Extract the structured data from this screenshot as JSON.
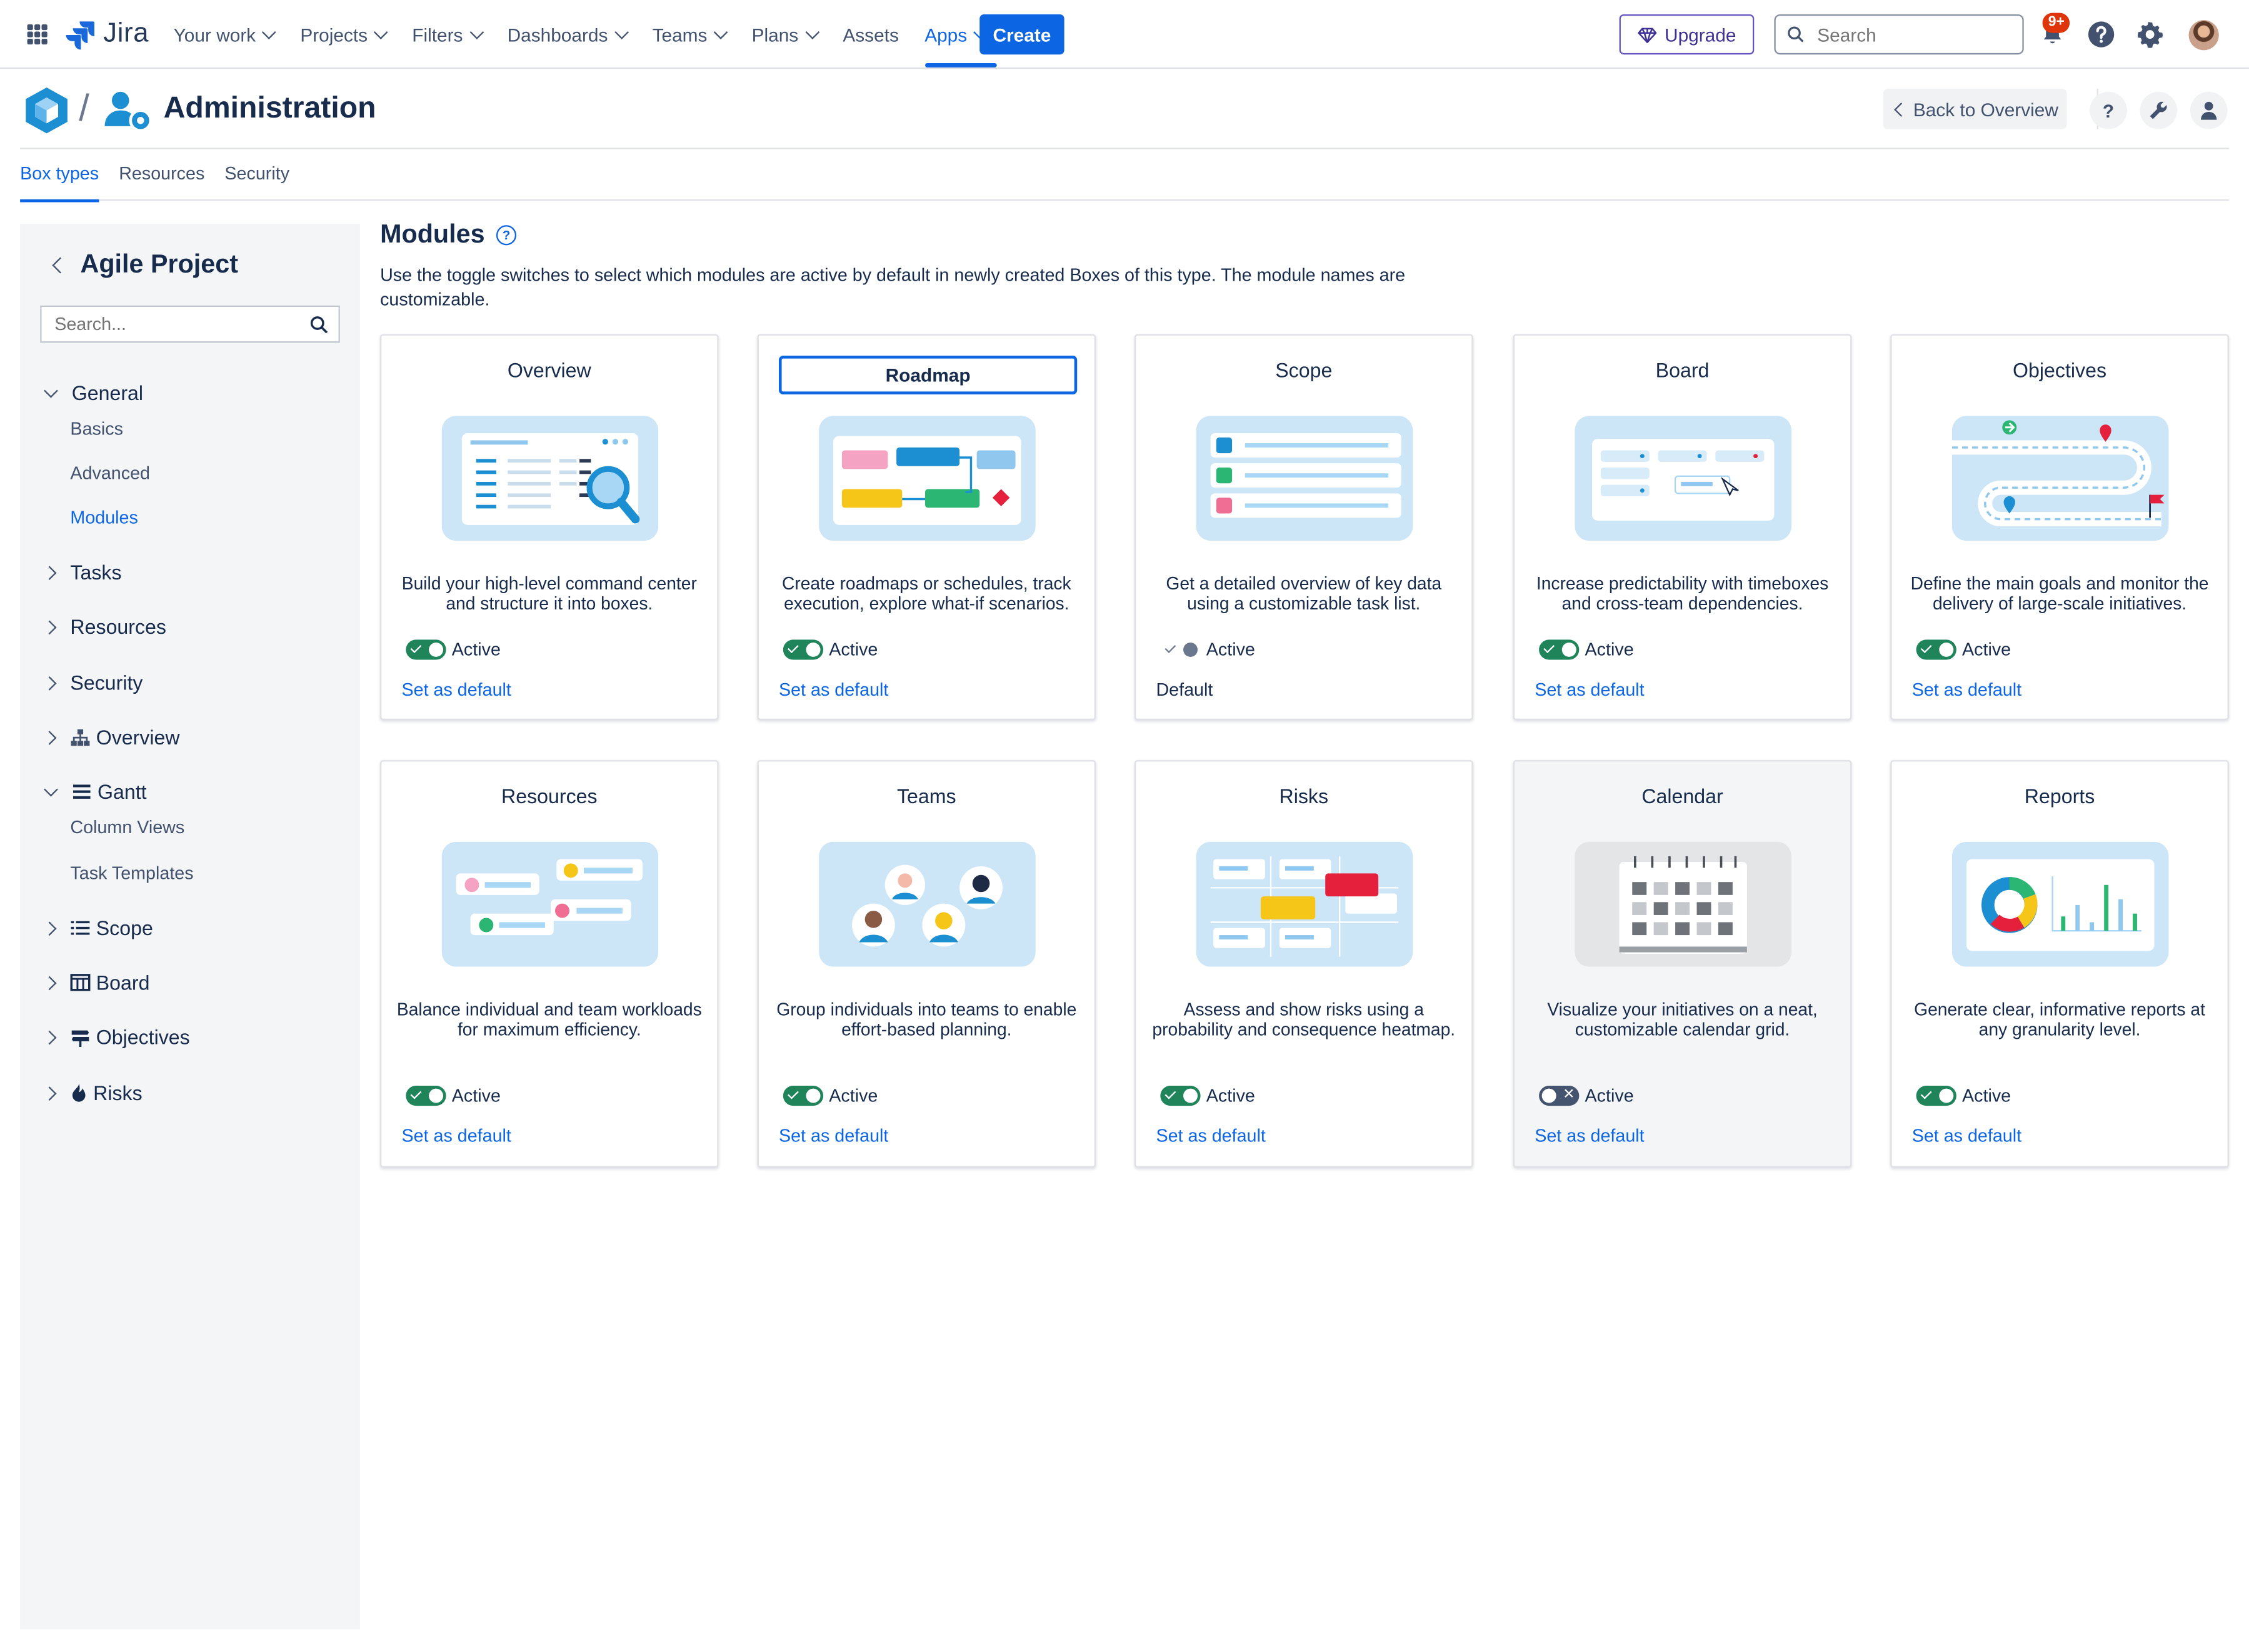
{
  "nav": {
    "product": "Jira",
    "items": [
      {
        "label": "Your work",
        "dropdown": true
      },
      {
        "label": "Projects",
        "dropdown": true
      },
      {
        "label": "Filters",
        "dropdown": true
      },
      {
        "label": "Dashboards",
        "dropdown": true
      },
      {
        "label": "Teams",
        "dropdown": true
      },
      {
        "label": "Plans",
        "dropdown": true
      },
      {
        "label": "Assets",
        "dropdown": false
      },
      {
        "label": "Apps",
        "dropdown": true,
        "active": true
      }
    ],
    "create_label": "Create",
    "upgrade_label": "Upgrade",
    "search_placeholder": "Search",
    "notifications_badge": "9+",
    "accent": "#0C66E4"
  },
  "admin": {
    "title": "Administration",
    "back_label": "Back to Overview",
    "help_glyph": "?"
  },
  "tabs": [
    {
      "label": "Box types",
      "active": true
    },
    {
      "label": "Resources",
      "active": false
    },
    {
      "label": "Security",
      "active": false
    }
  ],
  "sidebar": {
    "title": "Agile Project",
    "search_placeholder": "Search...",
    "groups": [
      {
        "label": "General",
        "expanded": true,
        "icon": null,
        "children": [
          {
            "label": "Basics",
            "active": false
          },
          {
            "label": "Advanced",
            "active": false
          },
          {
            "label": "Modules",
            "active": true
          }
        ]
      },
      {
        "label": "Tasks",
        "expanded": false,
        "icon": null
      },
      {
        "label": "Resources",
        "expanded": false,
        "icon": null
      },
      {
        "label": "Security",
        "expanded": false,
        "icon": null
      },
      {
        "label": "Overview",
        "expanded": false,
        "icon": "hierarchy-icon"
      },
      {
        "label": "Gantt",
        "expanded": true,
        "icon": "gantt-lines-icon",
        "children": [
          {
            "label": "Column Views",
            "active": false
          },
          {
            "label": "Task Templates",
            "active": false
          }
        ]
      },
      {
        "label": "Scope",
        "expanded": false,
        "icon": "list-icon"
      },
      {
        "label": "Board",
        "expanded": false,
        "icon": "board-icon"
      },
      {
        "label": "Objectives",
        "expanded": false,
        "icon": "signpost-icon"
      },
      {
        "label": "Risks",
        "expanded": false,
        "icon": "flame-icon"
      }
    ]
  },
  "modules": {
    "title": "Modules",
    "description": "Use the toggle switches to select which modules are active by default in newly created Boxes of this type. The module names are customizable.",
    "active_label": "Active",
    "set_default_label": "Set as default",
    "default_label": "Default",
    "cards": [
      {
        "name": "Overview",
        "description": "Build your high-level command center and structure it into boxes.",
        "active": true,
        "is_default": false,
        "illustration": "overview-dashboard-illustration"
      },
      {
        "name": "Roadmap",
        "description": "Create roadmaps or schedules, track execution, explore what-if scenarios.",
        "active": true,
        "is_default": false,
        "editing": true,
        "illustration": "roadmap-illustration"
      },
      {
        "name": "Scope",
        "description": "Get a detailed overview of key data using a customizable task list.",
        "active": true,
        "is_default": true,
        "illustration": "scope-list-illustration"
      },
      {
        "name": "Board",
        "description": "Increase predictability with timeboxes and cross-team dependencies.",
        "active": true,
        "is_default": false,
        "illustration": "board-illustration"
      },
      {
        "name": "Objectives",
        "description": "Define the main goals and monitor the delivery of large-scale initiatives.",
        "active": true,
        "is_default": false,
        "illustration": "objectives-path-illustration"
      },
      {
        "name": "Resources",
        "description": "Balance individual and team workloads for maximum efficiency.",
        "active": true,
        "is_default": false,
        "illustration": "resources-people-illustration"
      },
      {
        "name": "Teams",
        "description": "Group individuals into teams to enable effort-based planning.",
        "active": true,
        "is_default": false,
        "illustration": "teams-illustration"
      },
      {
        "name": "Risks",
        "description": "Assess and show risks using a probability and consequence heatmap.",
        "active": true,
        "is_default": false,
        "illustration": "risks-matrix-illustration"
      },
      {
        "name": "Calendar",
        "description": "Visualize your initiatives on a neat, customizable calendar grid.",
        "active": false,
        "is_default": false,
        "illustration": "calendar-illustration"
      },
      {
        "name": "Reports",
        "description": "Generate clear, informative reports at any granularity level.",
        "active": true,
        "is_default": false,
        "illustration": "reports-chart-illustration"
      }
    ]
  }
}
